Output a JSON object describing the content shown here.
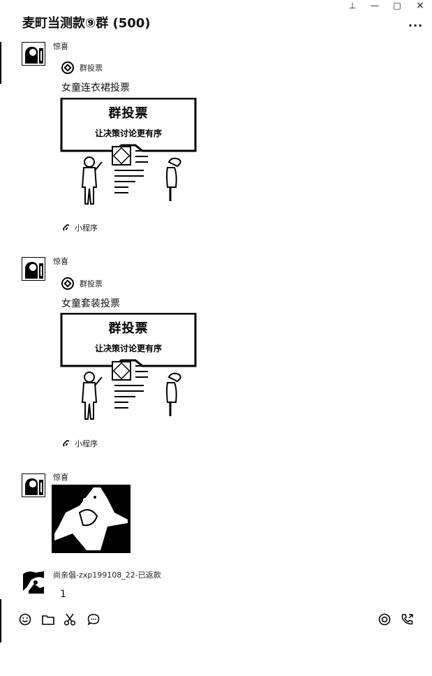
{
  "window": {
    "title": "麦町当测款⑨群 (500)",
    "controls": {
      "pin": "⊥",
      "minimize": "—",
      "maximize": "□",
      "close": "×"
    },
    "more": "..."
  },
  "messages": [
    {
      "sender": "惊喜",
      "type": "mini-program",
      "source_name": "群投票",
      "title": "女童连衣裙投票",
      "banner_line1": "群投票",
      "banner_line2": "让决策讨论更有序",
      "footer": "小程序"
    },
    {
      "sender": "惊喜",
      "type": "mini-program",
      "source_name": "群投票",
      "title": "女童套装投票",
      "banner_line1": "群投票",
      "banner_line2": "让决策讨论更有序",
      "footer": "小程序"
    },
    {
      "sender": "惊喜",
      "type": "image"
    },
    {
      "sender": "尚亲倡-zxp199108_22-已返款",
      "type": "text",
      "text": "1"
    }
  ],
  "toolbar": {
    "left_icons": [
      "emoji-icon",
      "folder-icon",
      "scissors-icon",
      "chat-bubble-icon"
    ],
    "right_icons": [
      "live-icon",
      "call-icon"
    ]
  }
}
